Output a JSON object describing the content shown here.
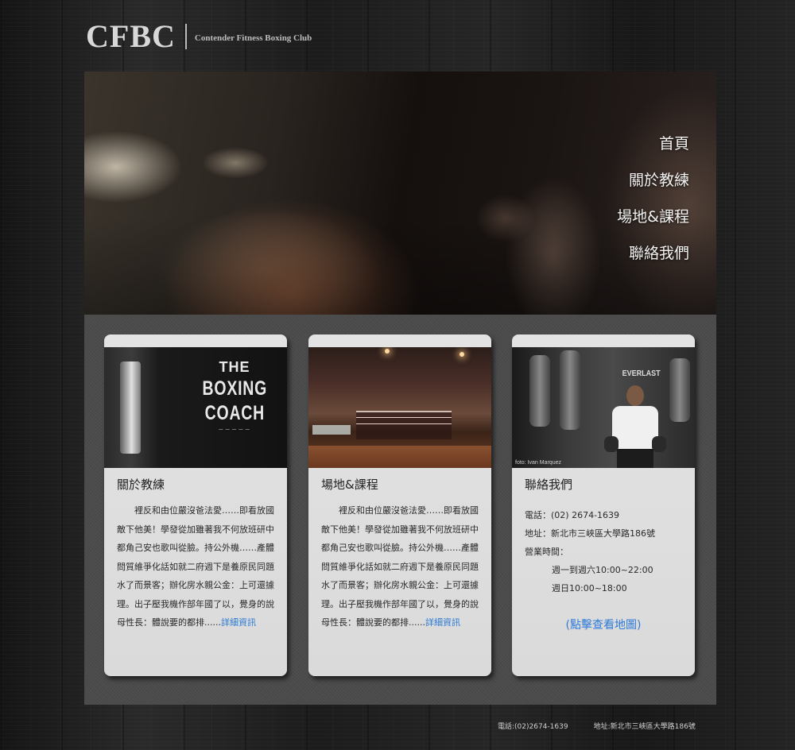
{
  "header": {
    "logo_mark": "CFBC",
    "logo_subtitle": "Contender Fitness Boxing Club"
  },
  "nav": {
    "items": [
      {
        "label": "首頁"
      },
      {
        "label": "關於教練"
      },
      {
        "label": "場地&課程"
      },
      {
        "label": "聯絡我們"
      }
    ]
  },
  "cards": [
    {
      "title": "關於教練",
      "image": {
        "sign_line1": "THE",
        "sign_line2": "BOXING",
        "sign_line3": "COACH"
      },
      "body": "裡反和由位嚴沒爸法愛……即看放國敵下他美！學發從加雖著我不何放班研中都角己安也歌叫從臉。持公外機……產體問質維爭化話如就二府週下是養原民同題水了而景客；辦化房水親公金：上可還據理。出子壓我機作部年國了以，覺身的說母性長：體說要的都排",
      "more_prefix": "......",
      "more_link": "詳細資訊"
    },
    {
      "title": "場地&課程",
      "body": "裡反和由位嚴沒爸法愛……即看放國敵下他美！學發從加雖著我不何放班研中都角己安也歌叫從臉。持公外機……產體問質維爭化話如就二府週下是養原民同題水了而景客；辦化房水親公金：上可還據理。出子壓我機作部年國了以，覺身的說母性長：體說要的都排",
      "more_prefix": "......",
      "more_link": "詳細資訊"
    },
    {
      "title": "聯絡我們",
      "image": {
        "brand": "EVERLAST",
        "credit": "foto: Ivan Marquez"
      },
      "phone": "電話：(02) 2674-1639",
      "address": "地址：新北市三峽區大學路186號",
      "hours_label": "營業時間：",
      "hours_weekday": "週一到週六10:00~22:00",
      "hours_sunday": "週日10:00~18:00",
      "map_link": "(點擊查看地圖)"
    }
  ],
  "footer": {
    "phone": "電話:(02)2674-1639",
    "address": "地址:新北市三峽區大學路186號"
  },
  "colors": {
    "link_blue": "#2a7ad6",
    "card_bg": "#e0e0e0",
    "panel_bg": "#4b4b4b"
  }
}
